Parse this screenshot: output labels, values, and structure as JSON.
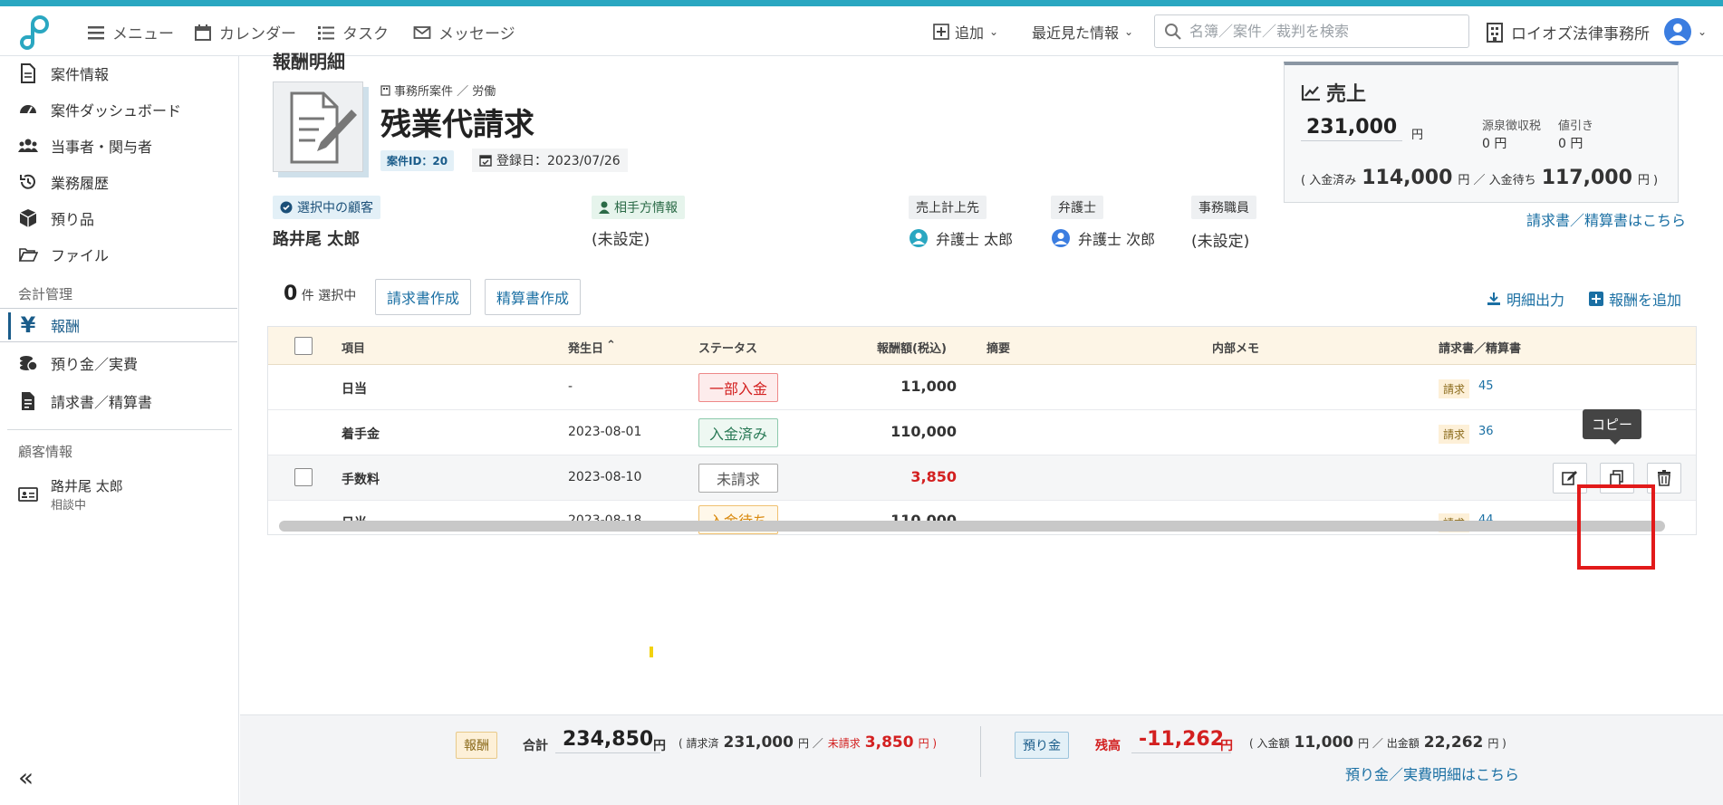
{
  "topbar": {
    "menu": "メニュー",
    "calendar": "カレンダー",
    "task": "タスク",
    "message": "メッセージ",
    "add": "追加",
    "recent": "最近見た情報",
    "search_placeholder": "名簿／案件／裁判を検索",
    "office": "ロイオズ法律事務所"
  },
  "sidebar": {
    "items": [
      {
        "label": "案件情報",
        "icon": "document-icon"
      },
      {
        "label": "案件ダッシュボード",
        "icon": "dashboard-icon"
      },
      {
        "label": "当事者・関与者",
        "icon": "people-icon"
      },
      {
        "label": "業務履歴",
        "icon": "history-icon"
      },
      {
        "label": "預り品",
        "icon": "box-icon"
      },
      {
        "label": "ファイル",
        "icon": "folder-icon"
      }
    ],
    "accounting_section": "会計管理",
    "accounting_items": [
      {
        "label": "報酬",
        "icon": "yen-icon"
      },
      {
        "label": "預り金／実費",
        "icon": "coins-icon"
      },
      {
        "label": "請求書／精算書",
        "icon": "invoice-icon"
      }
    ],
    "client_section": "顧客情報",
    "client": {
      "name": "路井尾 太郎",
      "status": "相談中"
    }
  },
  "case": {
    "cut_title": "報酬明細",
    "breadcrumb": "事務所案件 ／ 労働",
    "title": "残業代請求",
    "id_label": "案件ID：20",
    "registered": "登録日：2023/07/26"
  },
  "info": {
    "client_label": "選択中の顧客",
    "client_name": "路井尾 太郎",
    "opponent_label": "相手方情報",
    "opponent_value": "(未設定)",
    "sales_target_label": "売上計上先",
    "sales_target": "弁護士 太郎",
    "lawyer_label": "弁護士",
    "lawyer": "弁護士 次郎",
    "staff_label": "事務職員",
    "staff": "(未設定)"
  },
  "sales": {
    "title": "売上",
    "amount": "231,000",
    "yen": "円",
    "withholding_label": "源泉徴収税",
    "withholding": "0 円",
    "discount_label": "値引き",
    "discount": "0 円",
    "paid_prefix": "( 入金済み",
    "paid": "114,000",
    "mid": "円 ／ 入金待ち",
    "waiting": "117,000",
    "suffix": "円 )",
    "link": "請求書／精算書はこちら"
  },
  "actions": {
    "selected_count": "0",
    "selected_suffix": "件 選択中",
    "invoice_btn": "請求書作成",
    "settle_btn": "精算書作成",
    "export": "明細出力",
    "add_fee": "報酬を追加"
  },
  "table": {
    "headers": {
      "item": "項目",
      "date": "発生日",
      "status": "ステータス",
      "amount": "報酬額(税込)",
      "summary": "摘要",
      "memo": "内部メモ",
      "invoice": "請求書／精算書"
    },
    "rows": [
      {
        "item": "日当",
        "date": "-",
        "status": "一部入金",
        "amount": "11,000",
        "inv_tag": "請求",
        "inv_num": "45"
      },
      {
        "item": "着手金",
        "date": "2023-08-01",
        "status": "入金済み",
        "amount": "110,000",
        "inv_tag": "請求",
        "inv_num": "36"
      },
      {
        "item": "手数料",
        "date": "2023-08-10",
        "status": "未請求",
        "amount": "3,850",
        "inv_tag": "",
        "inv_num": ""
      },
      {
        "item": "日当",
        "date": "2023-08-18",
        "status": "入金待ち",
        "amount": "110,000",
        "inv_tag": "請求",
        "inv_num": "44"
      }
    ],
    "tooltip": "コピー"
  },
  "footer": {
    "fee_tag": "報酬",
    "total_label": "合計",
    "total": "234,850",
    "yen": "円",
    "billed_prefix": "( 請求済",
    "billed": "231,000",
    "billed_mid": "円 ／",
    "unbilled_label": "未請求",
    "unbilled": "3,850",
    "unbilled_suffix": "円 )",
    "deposit_tag": "預り金",
    "balance_label": "残高",
    "balance": "-11,262",
    "in_prefix": "( 入金額",
    "in_amount": "11,000",
    "out_mid": "円 ／ 出金額",
    "out_amount": "22,262",
    "out_suffix": "円 )",
    "deposit_link": "預り金／実費明細はこちら"
  }
}
